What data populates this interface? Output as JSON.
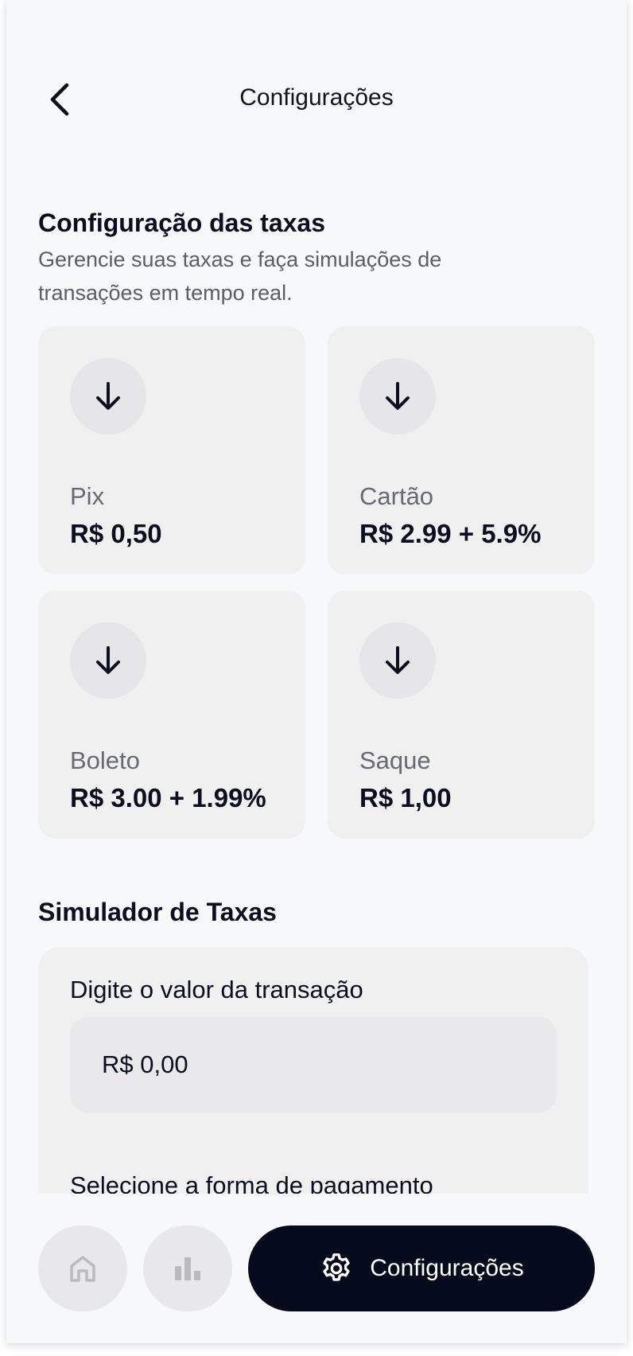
{
  "header": {
    "title": "Configurações",
    "back_icon": "chevron-left-icon"
  },
  "fees": {
    "title": "Configuração das taxas",
    "description": "Gerencie suas taxas e faça simulações de transações em tempo real.",
    "items": [
      {
        "label": "Pix",
        "value": "R$ 0,50",
        "icon": "arrow-down-icon"
      },
      {
        "label": "Cartão",
        "value": "R$ 2.99 + 5.9%",
        "icon": "arrow-down-icon"
      },
      {
        "label": "Boleto",
        "value": "R$ 3.00 + 1.99%",
        "icon": "arrow-down-icon"
      },
      {
        "label": "Saque",
        "value": "R$ 1,00",
        "icon": "arrow-down-icon"
      }
    ]
  },
  "simulator": {
    "title": "Simulador de Taxas",
    "amount_label": "Digite o valor da transação",
    "amount_value": "R$ 0,00",
    "payment_label": "Selecione a forma de pagamento"
  },
  "bottom_nav": {
    "items": [
      {
        "icon": "home-icon"
      },
      {
        "icon": "bar-chart-icon"
      },
      {
        "icon": "gear-icon",
        "label": "Configurações"
      }
    ]
  },
  "colors": {
    "background": "#f7f8fa",
    "card": "#f0f0f1",
    "primary_dark": "#060a1d",
    "muted_text": "#5b5e67"
  }
}
